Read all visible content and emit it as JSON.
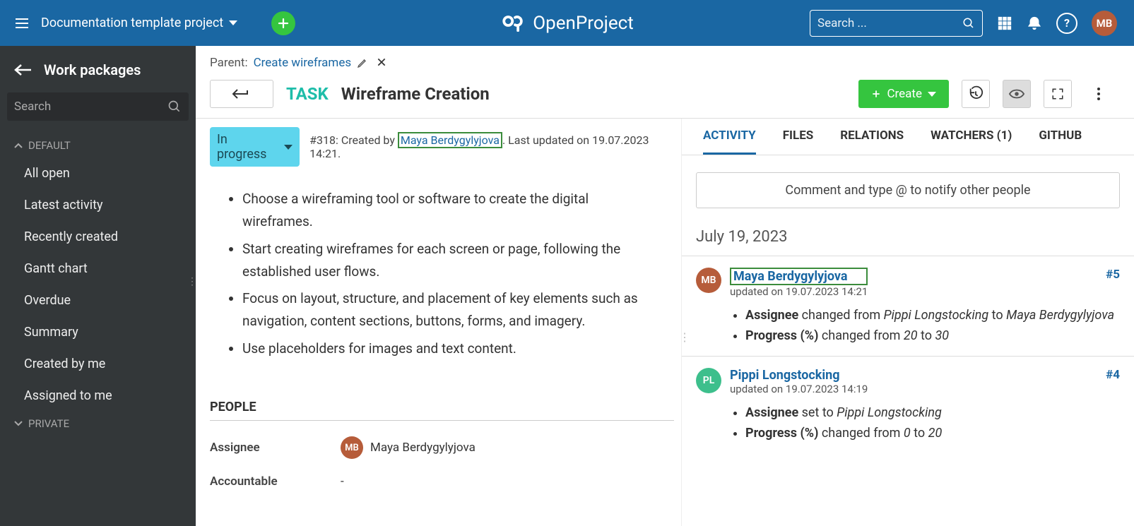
{
  "header": {
    "project": "Documentation template project",
    "search_placeholder": "Search ...",
    "brand": "OpenProject",
    "avatar_initials": "MB",
    "help_label": "?"
  },
  "sidebar": {
    "title": "Work packages",
    "search_placeholder": "Search",
    "groups": {
      "default": {
        "label": "DEFAULT",
        "items": [
          "All open",
          "Latest activity",
          "Recently created",
          "Gantt chart",
          "Overdue",
          "Summary",
          "Created by me",
          "Assigned to me"
        ]
      },
      "private": {
        "label": "PRIVATE"
      }
    }
  },
  "crumb": {
    "parent_label": "Parent:",
    "parent_link": "Create wireframes"
  },
  "title_row": {
    "type": "TASK",
    "title": "Wireframe Creation",
    "create_label": "Create"
  },
  "meta": {
    "status": "In progress",
    "id_prefix": "#318: Created by",
    "creator": "Maya Berdygylyjova",
    "updated_suffix": ". Last updated on 19.07.2023 14:21."
  },
  "description": [
    "Choose a wireframing tool or software to create the digital wireframes.",
    "Start creating wireframes for each screen or page, following the established user flows.",
    "Focus on layout, structure, and placement of key elements such as navigation, content sections, buttons, forms, and imagery.",
    "Use placeholders for images and text content."
  ],
  "people": {
    "heading": "PEOPLE",
    "assignee_label": "Assignee",
    "assignee_name": "Maya Berdygylyjova",
    "assignee_initials": "MB",
    "accountable_label": "Accountable",
    "accountable_value": "-"
  },
  "tabs": {
    "activity": "ACTIVITY",
    "files": "FILES",
    "relations": "RELATIONS",
    "watchers": "WATCHERS (1)",
    "github": "GITHUB"
  },
  "activity": {
    "comment_hint": "Comment and type @ to notify other people",
    "date_heading": "July 19, 2023",
    "entries": [
      {
        "initials": "MB",
        "avatar_class": "mb",
        "user": "Maya Berdygylyjova",
        "boxed": true,
        "sub": "updated on 19.07.2023 14:21",
        "anchor": "#5",
        "changes": [
          {
            "field": "Assignee",
            "text_before": " changed from ",
            "from": "Pippi Longstocking",
            "mid": " to ",
            "to": "Maya Berdygylyjova"
          },
          {
            "field": "Progress (%)",
            "text_before": " changed from ",
            "from": "20",
            "mid": " to ",
            "to": "30"
          }
        ]
      },
      {
        "initials": "PL",
        "avatar_class": "pl",
        "user": "Pippi Longstocking",
        "boxed": false,
        "sub": "updated on 19.07.2023 14:19",
        "anchor": "#4",
        "changes": [
          {
            "field": "Assignee",
            "text_before": " set to ",
            "from": "Pippi Longstocking",
            "mid": "",
            "to": ""
          },
          {
            "field": "Progress (%)",
            "text_before": " changed from ",
            "from": "0",
            "mid": " to ",
            "to": "20"
          }
        ]
      }
    ]
  }
}
